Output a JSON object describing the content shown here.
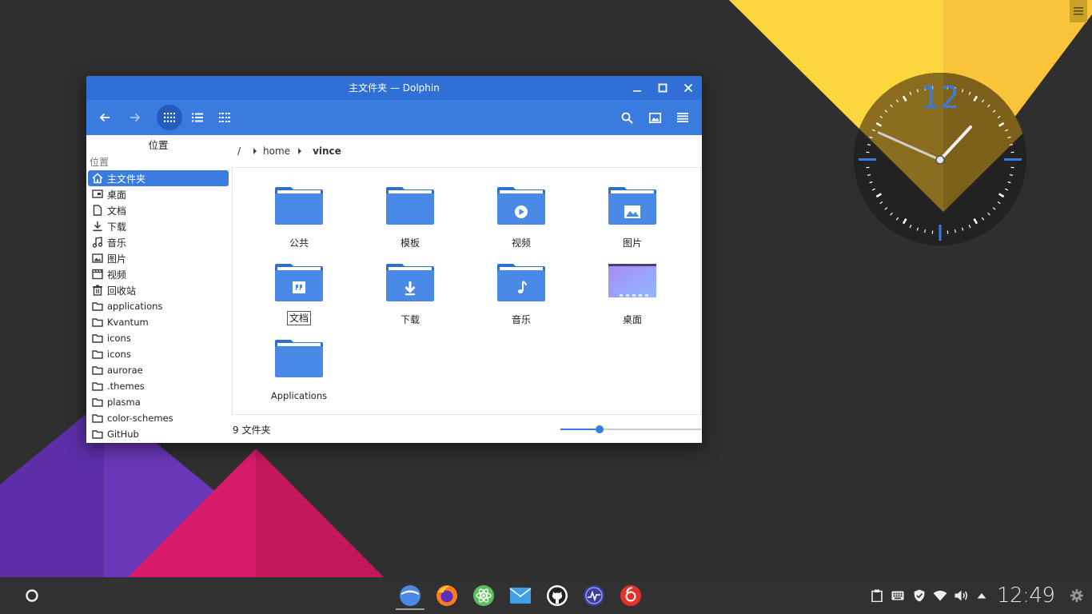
{
  "window": {
    "title": "主文件夹 — Dolphin",
    "minimize_icon": "minimize-icon",
    "maximize_icon": "maximize-icon",
    "close_icon": "close-icon"
  },
  "toolbar": {
    "back_icon": "arrow-left-icon",
    "forward_icon": "arrow-right-icon",
    "view_modes": [
      "icons-view",
      "details-view",
      "compact-view"
    ],
    "active_view": "icons-view",
    "search_icon": "search-icon",
    "preview_icon": "image-icon",
    "menu_icon": "hamburger-icon"
  },
  "sidebar": {
    "header": "位置",
    "section": "位置",
    "items": [
      {
        "label": "主文件夹",
        "icon": "home-icon",
        "selected": true
      },
      {
        "label": "桌面",
        "icon": "desktop-icon"
      },
      {
        "label": "文档",
        "icon": "document-icon"
      },
      {
        "label": "下载",
        "icon": "download-icon"
      },
      {
        "label": "音乐",
        "icon": "music-icon"
      },
      {
        "label": "图片",
        "icon": "picture-icon"
      },
      {
        "label": "视频",
        "icon": "video-icon"
      },
      {
        "label": "回收站",
        "icon": "trash-icon"
      },
      {
        "label": "applications",
        "icon": "folder-icon"
      },
      {
        "label": "Kvantum",
        "icon": "folder-icon"
      },
      {
        "label": "icons",
        "icon": "folder-icon"
      },
      {
        "label": "icons",
        "icon": "folder-icon"
      },
      {
        "label": "aurorae",
        "icon": "folder-icon"
      },
      {
        "label": ".themes",
        "icon": "folder-icon"
      },
      {
        "label": "plasma",
        "icon": "folder-icon"
      },
      {
        "label": "color-schemes",
        "icon": "folder-icon"
      },
      {
        "label": "GitHub",
        "icon": "folder-icon"
      }
    ]
  },
  "breadcrumb": {
    "root": "/",
    "parts": [
      "home",
      "vince"
    ]
  },
  "files": [
    {
      "name": "公共",
      "emblem": "none"
    },
    {
      "name": "模板",
      "emblem": "none"
    },
    {
      "name": "视频",
      "emblem": "play-icon"
    },
    {
      "name": "图片",
      "emblem": "picture-icon"
    },
    {
      "name": "文档",
      "emblem": "quote-icon",
      "focused": true
    },
    {
      "name": "下载",
      "emblem": "download-icon"
    },
    {
      "name": "音乐",
      "emblem": "music-note-icon"
    },
    {
      "name": "桌面",
      "emblem": "desktop-thumbnail"
    },
    {
      "name": "Applications",
      "emblem": "none"
    }
  ],
  "status": {
    "text": "9 文件夹",
    "zoom_level": 0.28
  },
  "clock_widget": {
    "twelve_label": "12",
    "hour": 12,
    "minute": 49
  },
  "panel": {
    "launcher_icon": "launcher-icon",
    "tasks": [
      {
        "name": "dolphin-icon",
        "active": true
      },
      {
        "name": "firefox-icon"
      },
      {
        "name": "atom-icon"
      },
      {
        "name": "mail-icon"
      },
      {
        "name": "github-icon"
      },
      {
        "name": "system-monitor-icon"
      },
      {
        "name": "netease-music-icon"
      }
    ],
    "tray": [
      "clipboard-icon",
      "keyboard-icon",
      "shield-icon",
      "wifi-icon",
      "volume-icon",
      "expand-arrow-icon"
    ],
    "clock": "12:49",
    "settings_icon": "gear-icon"
  },
  "colors": {
    "accent": "#3a7bdf",
    "titlebar": "#2f6fd6",
    "folder": "#4a8ae6",
    "desktop_bg": "#2f2f2f"
  }
}
